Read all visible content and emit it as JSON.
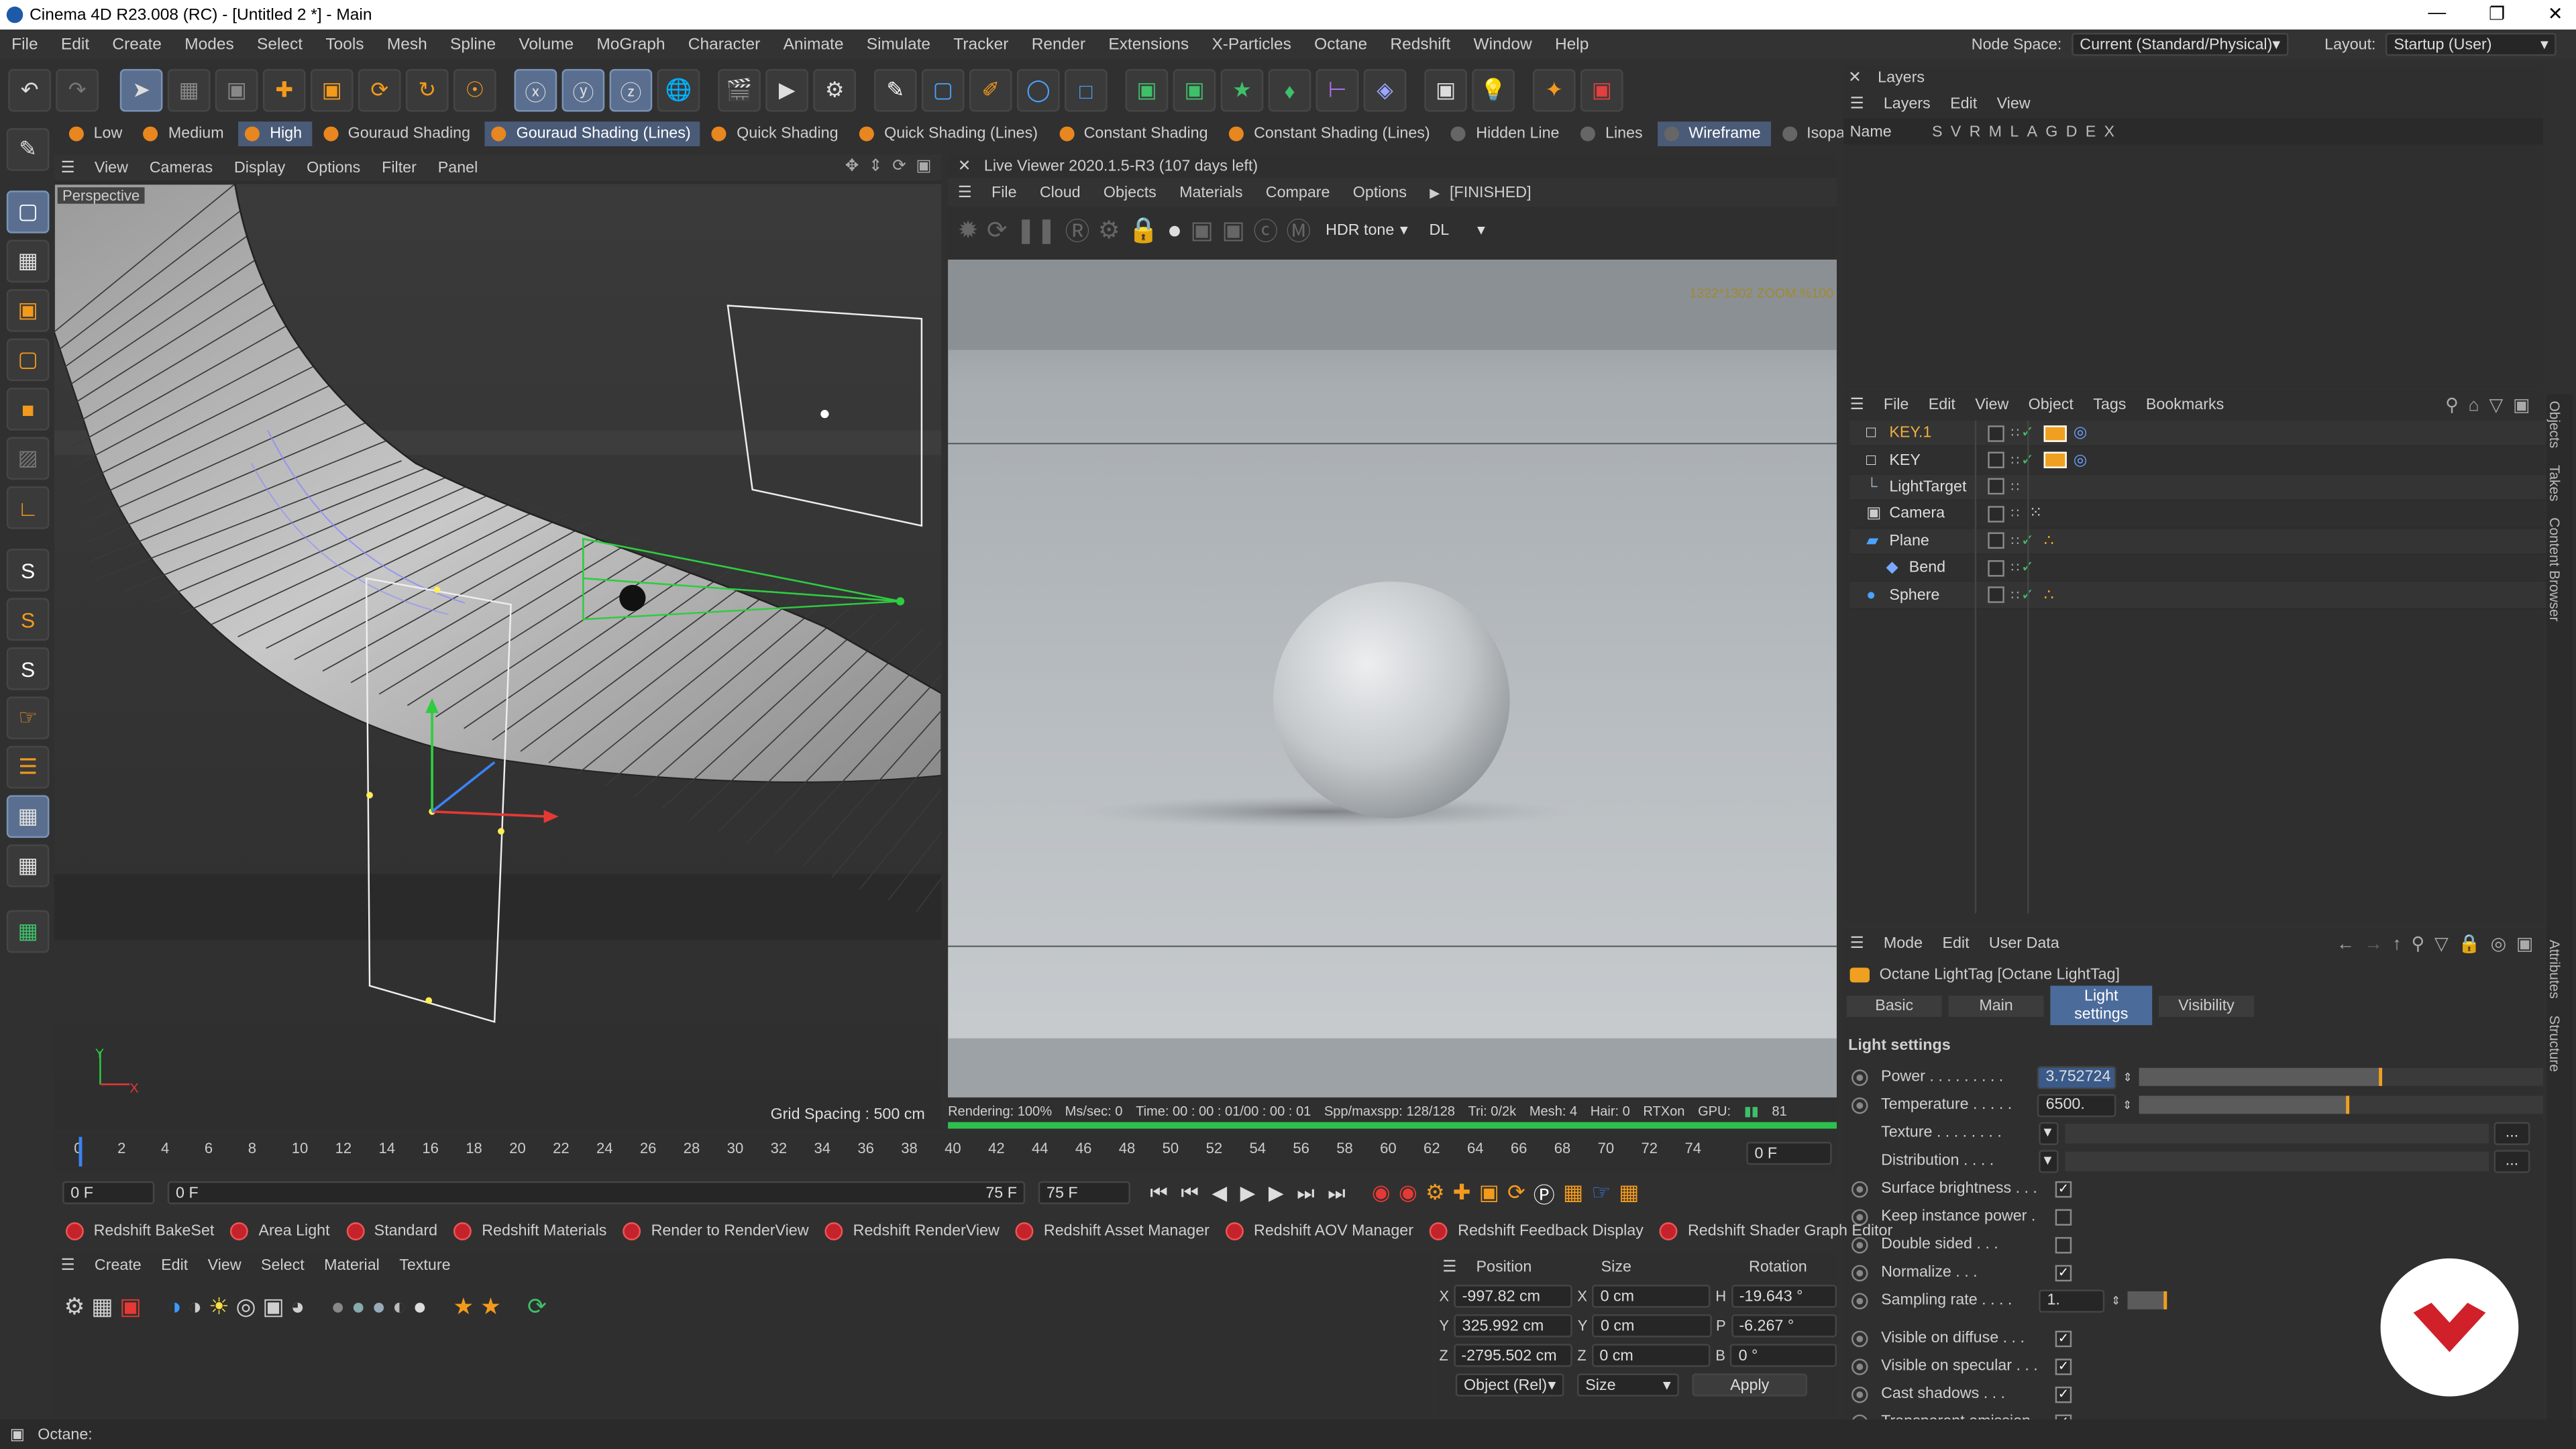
{
  "window": {
    "title": "Cinema 4D R23.008 (RC) - [Untitled 2 *] - Main",
    "controls": [
      "—",
      "❐",
      "✕"
    ]
  },
  "menubar": {
    "items": [
      "File",
      "Edit",
      "Create",
      "Modes",
      "Select",
      "Tools",
      "Mesh",
      "Spline",
      "Volume",
      "MoGraph",
      "Character",
      "Animate",
      "Simulate",
      "Tracker",
      "Render",
      "Extensions",
      "X-Particles",
      "Octane",
      "Redshift",
      "Window",
      "Help"
    ],
    "node_space_label": "Node Space:",
    "node_space_value": "Current (Standard/Physical)",
    "layout_label": "Layout:",
    "layout_value": "Startup (User)"
  },
  "shading_bar": {
    "items": [
      "Low",
      "Medium",
      "High",
      "Gouraud Shading",
      "Gouraud Shading (Lines)",
      "Quick Shading",
      "Quick Shading (Lines)",
      "Constant Shading",
      "Constant Shading (Lines)",
      "Hidden Line",
      "Lines",
      "Wireframe",
      "Isoparms"
    ]
  },
  "viewport": {
    "menu": [
      "View",
      "Cameras",
      "Display",
      "Options",
      "Filter",
      "Panel"
    ],
    "label": "Perspective",
    "grid_spacing": "Grid Spacing : 500 cm"
  },
  "live_viewer": {
    "title": "Live Viewer 2020.1.5-R3 (107 days left)",
    "menu": [
      "File",
      "Cloud",
      "Objects",
      "Materials",
      "Compare",
      "Options"
    ],
    "status_tag": "[FINISHED]",
    "tone": "HDR tone",
    "dl": "DL",
    "zoom_text": "1322*1302 ZOOM:%100",
    "status": {
      "rendering": "Rendering: 100%",
      "ms": "Ms/sec: 0",
      "time": "Time: 00 : 00 : 01/00 : 00 : 01",
      "spp": "Spp/maxspp: 128/128",
      "tri": "Tri: 0/2k",
      "mesh": "Mesh: 4",
      "hair": "Hair: 0",
      "rtx": "RTXon",
      "gpu": "GPU:",
      "gpu_val": "81"
    }
  },
  "layers": {
    "title": "Layers",
    "menu": [
      "Layers",
      "Edit",
      "View"
    ],
    "cols": "Name",
    "flags": [
      "S",
      "V",
      "R",
      "M",
      "L",
      "A",
      "G",
      "D",
      "E",
      "X"
    ]
  },
  "objects": {
    "menu": [
      "File",
      "Edit",
      "View",
      "Object",
      "Tags",
      "Bookmarks"
    ],
    "items": [
      {
        "name": "KEY.1",
        "indent": 0,
        "sel": true
      },
      {
        "name": "KEY",
        "indent": 0,
        "sel": false
      },
      {
        "name": "LightTarget",
        "indent": 0,
        "sel": false
      },
      {
        "name": "Camera",
        "indent": 0,
        "sel": false
      },
      {
        "name": "Plane",
        "indent": 0,
        "sel": false
      },
      {
        "name": "Bend",
        "indent": 1,
        "sel": false
      },
      {
        "name": "Sphere",
        "indent": 0,
        "sel": false
      }
    ],
    "side_tabs": [
      "Objects",
      "Takes",
      "Content Browser"
    ]
  },
  "attributes": {
    "menu": [
      "Mode",
      "Edit",
      "User Data"
    ],
    "header": "Octane LightTag [Octane LightTag]",
    "tabs": [
      "Basic",
      "Main",
      "Light settings",
      "Visibility"
    ],
    "active_tab": "Light settings",
    "section": "Light settings",
    "power_label": "Power",
    "power_value": "3.752724",
    "power_fill": 0.6,
    "temp_label": "Temperature",
    "temp_value": "6500.",
    "temp_fill": 0.52,
    "texture_label": "Texture",
    "distribution_label": "Distribution",
    "checks": [
      {
        "label": "Surface brightness",
        "on": true
      },
      {
        "label": "Keep instance power",
        "on": false
      },
      {
        "label": "Double sided",
        "on": false
      },
      {
        "label": "Normalize",
        "on": true
      }
    ],
    "sampling_label": "Sampling rate",
    "sampling_value": "1.",
    "checks2": [
      {
        "label": "Visible on diffuse",
        "on": true
      },
      {
        "label": "Visible on specular",
        "on": true
      },
      {
        "label": "Cast shadows",
        "on": true
      },
      {
        "label": "Transparent emission",
        "on": true
      }
    ],
    "side_tabs": [
      "Attributes",
      "Structure"
    ]
  },
  "timeline": {
    "ticks": [
      "0",
      "2",
      "4",
      "6",
      "8",
      "10",
      "12",
      "14",
      "16",
      "18",
      "20",
      "22",
      "24",
      "26",
      "28",
      "30",
      "32",
      "34",
      "36",
      "38",
      "40",
      "42",
      "44",
      "46",
      "48",
      "50",
      "52",
      "54",
      "56",
      "58",
      "60",
      "62",
      "64",
      "66",
      "68",
      "70",
      "72",
      "74"
    ],
    "frame_field": "0 F",
    "start": "0 F",
    "start2": "0 F",
    "end": "75 F",
    "end2": "75 F"
  },
  "redshift_bar": {
    "items": [
      "Redshift BakeSet",
      "Area Light",
      "Standard",
      "Redshift Materials",
      "Render to RenderView",
      "Redshift RenderView",
      "Redshift Asset Manager",
      "Redshift AOV Manager",
      "Redshift Feedback Display",
      "Redshift Shader Graph Editor"
    ]
  },
  "material_manager": {
    "menu": [
      "Create",
      "Edit",
      "View",
      "Select",
      "Material",
      "Texture"
    ]
  },
  "coordinates": {
    "headers": [
      "Position",
      "Size",
      "Rotation"
    ],
    "rows": [
      {
        "axis": "X",
        "pos": "-997.82 cm",
        "size_axis": "X",
        "size": "0 cm",
        "rot_axis": "H",
        "rot": "-19.643 °"
      },
      {
        "axis": "Y",
        "pos": "325.992 cm",
        "size_axis": "Y",
        "size": "0 cm",
        "rot_axis": "P",
        "rot": "-6.267 °"
      },
      {
        "axis": "Z",
        "pos": "-2795.502 cm",
        "size_axis": "Z",
        "size": "0 cm",
        "rot_axis": "B",
        "rot": "0 °"
      }
    ],
    "mode": "Object (Rel)",
    "size_mode": "Size",
    "apply": "Apply"
  },
  "statusbar": {
    "text": "Octane:"
  },
  "colors": {
    "accent": "#4b6b9b",
    "orange": "#e8861f",
    "red": "#c4232c",
    "panel": "#303030"
  }
}
